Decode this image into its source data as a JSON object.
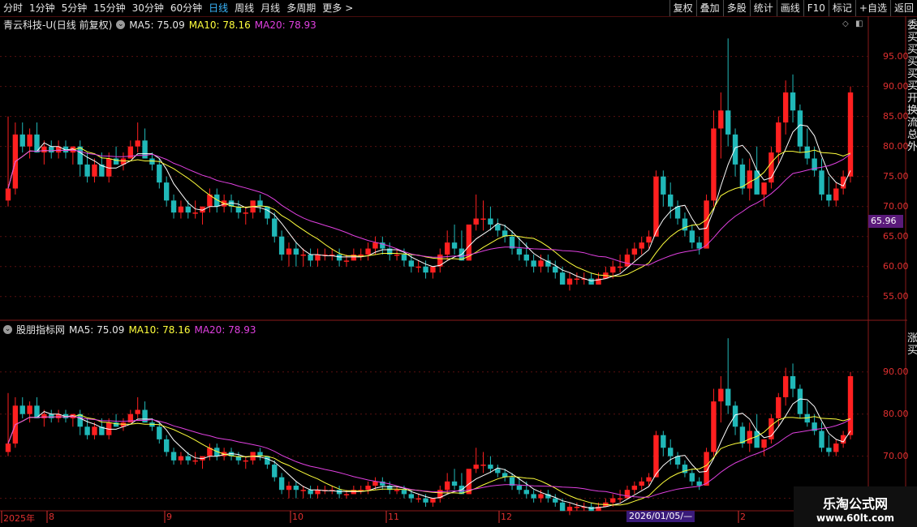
{
  "toolbar": {
    "periods": [
      "分时",
      "1分钟",
      "5分钟",
      "15分钟",
      "30分钟",
      "60分钟",
      "日线",
      "周线",
      "月线",
      "多周期",
      "更多"
    ],
    "active_period": "日线",
    "more_arrow": ">",
    "right_buttons": [
      "复权",
      "叠加",
      "多股",
      "统计",
      "画线",
      "F10",
      "标记",
      "+自选",
      "返回"
    ]
  },
  "main_panel": {
    "title": "青云科技-U(日线 前复权)",
    "ma5": "MA5: 75.09",
    "ma10": "MA10: 78.16",
    "ma20": "MA20: 78.93",
    "current_price_label": "65.96",
    "y_ticks": [
      "95.00",
      "90.00",
      "85.00",
      "80.00",
      "75.00",
      "70.00",
      "65.00",
      "60.00",
      "55.00"
    ]
  },
  "sub_panel": {
    "title": "股朋指标网",
    "ma5": "MA5: 75.09",
    "ma10": "MA10: 78.16",
    "ma20": "MA20: 78.93",
    "y_ticks": [
      "90.00",
      "80.00",
      "70.00",
      "60.00"
    ]
  },
  "x_axis": {
    "labels": [
      "2025年",
      "8",
      "9",
      "10",
      "11",
      "12",
      "2026/01/05/—",
      "2"
    ],
    "hover_date": "2026/01/05/—"
  },
  "right_strip": {
    "text_top": "委买买买买买开换流总外",
    "text_bottom": "涨买"
  },
  "watermark": {
    "name": "乐淘公式网",
    "url": "www.60lt.com"
  },
  "colors": {
    "up": "#ff2020",
    "down": "#20b8b8",
    "ma5": "#ffffff",
    "ma10": "#ffff3c",
    "ma20": "#e040e0",
    "grid": "#5a1010",
    "accent": "#3ab8ff"
  },
  "chart_data": {
    "type": "candlestick",
    "ohlc": [
      [
        71,
        85,
        70,
        73
      ],
      [
        73,
        84,
        72,
        82
      ],
      [
        82,
        84,
        79,
        80
      ],
      [
        80,
        83,
        78,
        82
      ],
      [
        82,
        84,
        79,
        79
      ],
      [
        79,
        81,
        77,
        80
      ],
      [
        80,
        81,
        78,
        79
      ],
      [
        79,
        81,
        78,
        80
      ],
      [
        80,
        81,
        78,
        79
      ],
      [
        79,
        80,
        77,
        80
      ],
      [
        80,
        81,
        75,
        77
      ],
      [
        77,
        79,
        74,
        75
      ],
      [
        75,
        78,
        74,
        77
      ],
      [
        77,
        79,
        75,
        75
      ],
      [
        75,
        79,
        74,
        78
      ],
      [
        78,
        80,
        77,
        77
      ],
      [
        77,
        79,
        76,
        78
      ],
      [
        78,
        81,
        78,
        80
      ],
      [
        80,
        84,
        79,
        81
      ],
      [
        81,
        83,
        78,
        78
      ],
      [
        78,
        79,
        76,
        77
      ],
      [
        77,
        78,
        73,
        74
      ],
      [
        74,
        75,
        70,
        71
      ],
      [
        71,
        72,
        68,
        69
      ],
      [
        69,
        71,
        68,
        70
      ],
      [
        70,
        71,
        68,
        69
      ],
      [
        69,
        71,
        68,
        69
      ],
      [
        69,
        70,
        67,
        70
      ],
      [
        70,
        73,
        69,
        72
      ],
      [
        72,
        73,
        69,
        70
      ],
      [
        70,
        72,
        69,
        71
      ],
      [
        71,
        72,
        69,
        70
      ],
      [
        70,
        71,
        68,
        69
      ],
      [
        69,
        70,
        67,
        69
      ],
      [
        69,
        71,
        68,
        71
      ],
      [
        71,
        72,
        69,
        70
      ],
      [
        70,
        70,
        67,
        68
      ],
      [
        68,
        69,
        64,
        65
      ],
      [
        65,
        66,
        61,
        62
      ],
      [
        62,
        64,
        60,
        63
      ],
      [
        63,
        64,
        60,
        62
      ],
      [
        62,
        63,
        60,
        62
      ],
      [
        62,
        63,
        60,
        61
      ],
      [
        61,
        63,
        60,
        62
      ],
      [
        62,
        63,
        61,
        62
      ],
      [
        62,
        63,
        61,
        62
      ],
      [
        62,
        63,
        60,
        61
      ],
      [
        61,
        62,
        60,
        61
      ],
      [
        61,
        63,
        61,
        62
      ],
      [
        62,
        63,
        61,
        62
      ],
      [
        62,
        64,
        61,
        63
      ],
      [
        63,
        65,
        62,
        64
      ],
      [
        64,
        65,
        62,
        63
      ],
      [
        63,
        64,
        61,
        62
      ],
      [
        62,
        63,
        61,
        62
      ],
      [
        62,
        63,
        60,
        61
      ],
      [
        61,
        62,
        59,
        60
      ],
      [
        60,
        61,
        59,
        60
      ],
      [
        60,
        61,
        58,
        59
      ],
      [
        59,
        60,
        58,
        60
      ],
      [
        60,
        63,
        59,
        62
      ],
      [
        62,
        66,
        61,
        64
      ],
      [
        64,
        67,
        62,
        63
      ],
      [
        63,
        66,
        61,
        61
      ],
      [
        61,
        65,
        61,
        67
      ],
      [
        67,
        72,
        66,
        68
      ],
      [
        68,
        71,
        66,
        68
      ],
      [
        68,
        70,
        66,
        67
      ],
      [
        67,
        68,
        65,
        66
      ],
      [
        66,
        67,
        64,
        65
      ],
      [
        65,
        66,
        62,
        63
      ],
      [
        63,
        65,
        61,
        62
      ],
      [
        62,
        64,
        60,
        61
      ],
      [
        61,
        62,
        59,
        60
      ],
      [
        60,
        62,
        59,
        61
      ],
      [
        61,
        62,
        59,
        60
      ],
      [
        60,
        61,
        58,
        59
      ],
      [
        59,
        60,
        57,
        57
      ],
      [
        57,
        59,
        56,
        58
      ],
      [
        58,
        59,
        57,
        58
      ],
      [
        58,
        59,
        57,
        58
      ],
      [
        58,
        59,
        57,
        57
      ],
      [
        57,
        59,
        57,
        58
      ],
      [
        58,
        60,
        58,
        59
      ],
      [
        59,
        61,
        58,
        60
      ],
      [
        60,
        62,
        59,
        60
      ],
      [
        60,
        63,
        60,
        62
      ],
      [
        62,
        64,
        61,
        63
      ],
      [
        63,
        65,
        62,
        64
      ],
      [
        64,
        66,
        63,
        65
      ],
      [
        65,
        76,
        65,
        75
      ],
      [
        75,
        76,
        70,
        72
      ],
      [
        72,
        74,
        68,
        70
      ],
      [
        70,
        71,
        67,
        68
      ],
      [
        68,
        69,
        65,
        66
      ],
      [
        66,
        67,
        63,
        64
      ],
      [
        64,
        65,
        62,
        63
      ],
      [
        63,
        72,
        63,
        71
      ],
      [
        71,
        86,
        70,
        83
      ],
      [
        83,
        89,
        78,
        86
      ],
      [
        86,
        98,
        80,
        82
      ],
      [
        82,
        83,
        75,
        77
      ],
      [
        77,
        78,
        72,
        73
      ],
      [
        73,
        78,
        71,
        76
      ],
      [
        76,
        80,
        73,
        72
      ],
      [
        72,
        74,
        70,
        74
      ],
      [
        74,
        80,
        73,
        79
      ],
      [
        79,
        85,
        77,
        84
      ],
      [
        84,
        91,
        82,
        89
      ],
      [
        89,
        92,
        84,
        86
      ],
      [
        86,
        87,
        79,
        80
      ],
      [
        80,
        83,
        77,
        78
      ],
      [
        78,
        80,
        75,
        76
      ],
      [
        76,
        78,
        71,
        72
      ],
      [
        72,
        75,
        70,
        71
      ],
      [
        71,
        74,
        70,
        73
      ],
      [
        73,
        76,
        72,
        75
      ],
      [
        75,
        90,
        74,
        89
      ]
    ],
    "ma5": "MA5: 75.09",
    "ma10": "MA10: 78.16",
    "ma20": "MA20: 78.93",
    "ylim_main": [
      52,
      99
    ],
    "ylim_sub": [
      58,
      99
    ]
  }
}
